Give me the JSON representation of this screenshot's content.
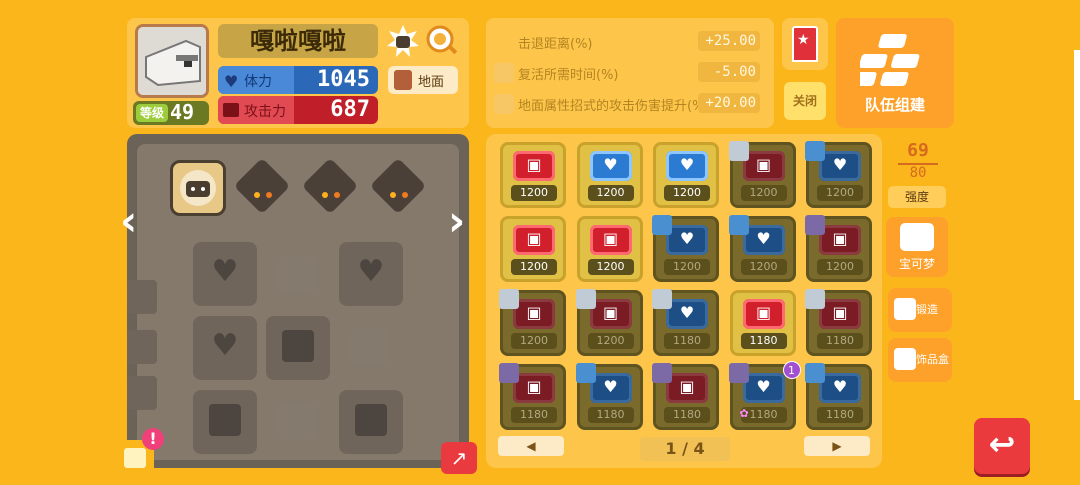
{
  "pokemon": {
    "name": "嘎啦嘎啦",
    "level_label": "等级",
    "level": "49",
    "hp_label": "体力",
    "hp": "1045",
    "atk_label": "攻击力",
    "atk": "687",
    "type": "地面"
  },
  "bonuses": [
    {
      "label": "击退距离(%)",
      "value": "+25.00"
    },
    {
      "label": "复活所需时间(%)",
      "value": "-5.00"
    },
    {
      "label": "地面属性招式的攻击伤害提升(%)",
      "value": "+20.00"
    }
  ],
  "buttons": {
    "close": "关闭",
    "team": "队伍组建",
    "strength": "强度",
    "pokemon": "宝可梦",
    "forge": "锻造",
    "decoration_box": "饰品盒",
    "prev": "◀",
    "next": "▶",
    "back": "↩",
    "share": "↗"
  },
  "alert": "!",
  "nav": {
    "left": "‹",
    "right": "›"
  },
  "strength": {
    "current": "69",
    "max": "80"
  },
  "pagination": {
    "indicator": "1 / 4"
  },
  "stones": [
    {
      "value": "1200",
      "color": "red",
      "state": "active"
    },
    {
      "value": "1200",
      "color": "blue",
      "state": "active"
    },
    {
      "value": "1200",
      "color": "blue",
      "state": "active"
    },
    {
      "value": "1200",
      "color": "red",
      "state": "dim",
      "marker": "white"
    },
    {
      "value": "1200",
      "color": "blue",
      "state": "dim",
      "marker": "blue"
    },
    {
      "value": "1200",
      "color": "red",
      "state": "active"
    },
    {
      "value": "1200",
      "color": "red",
      "state": "active"
    },
    {
      "value": "1200",
      "color": "blue",
      "state": "dim",
      "marker": "blue"
    },
    {
      "value": "1200",
      "color": "blue",
      "state": "dim",
      "marker": "blue"
    },
    {
      "value": "1200",
      "color": "red",
      "state": "dim",
      "marker": "purple"
    },
    {
      "value": "1200",
      "color": "red",
      "state": "dim",
      "marker": "white"
    },
    {
      "value": "1200",
      "color": "red",
      "state": "dim",
      "marker": "white"
    },
    {
      "value": "1180",
      "color": "blue",
      "state": "dim",
      "marker": "white"
    },
    {
      "value": "1180",
      "color": "red",
      "state": "active"
    },
    {
      "value": "1180",
      "color": "red",
      "state": "dim",
      "marker": "white"
    },
    {
      "value": "1180",
      "color": "red",
      "state": "dim",
      "marker": "purple"
    },
    {
      "value": "1180",
      "color": "blue",
      "state": "dim",
      "marker": "blue"
    },
    {
      "value": "1180",
      "color": "red",
      "state": "dim",
      "marker": "purple"
    },
    {
      "value": "1180",
      "color": "blue",
      "state": "dim",
      "marker": "purple",
      "badge": "1"
    },
    {
      "value": "1180",
      "color": "blue",
      "state": "dim",
      "marker": "blue"
    }
  ]
}
